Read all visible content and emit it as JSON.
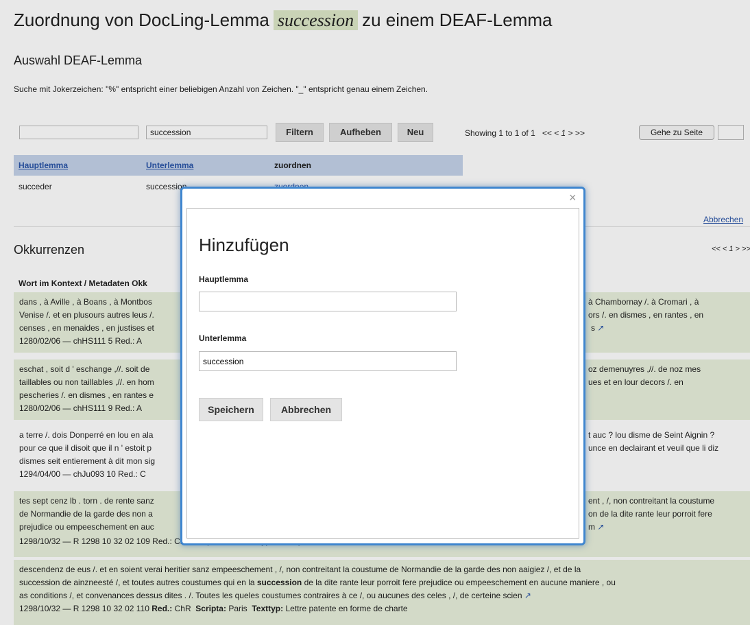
{
  "header": {
    "title_prefix": "Zuordnung von DocLing-Lemma",
    "title_lemma": "succession",
    "title_suffix": "zu einem DEAF-Lemma",
    "subtitle": "Auswahl DEAF-Lemma",
    "hint": "Suche mit Jokerzeichen: \"%\" entspricht einer beliebigen Anzahl von Zeichen. \"_\" entspricht genau einem Zeichen."
  },
  "filter": {
    "hauptlemma_value": "",
    "unterlemma_value": "succession",
    "filter_label": "Filtern",
    "reset_label": "Aufheben",
    "new_label": "Neu",
    "showing": "Showing 1 to 1 of 1",
    "pager": "<< < 1 > >>",
    "goto_label": "Gehe zu Seite",
    "goto_value": ""
  },
  "table": {
    "headers": [
      "Hauptlemma",
      "Unterlemma",
      "zuordnen"
    ],
    "row": [
      "succeder",
      "succession",
      "zuordnen"
    ]
  },
  "cancel_link": "Abbrechen",
  "occurrences": {
    "title": "Okkurrenzen",
    "pager": "<< < 1 > >>",
    "context_header": "Wort im Kontext / Metadaten Okk",
    "items": [
      {
        "left": "dans , à Aville , à Boans , à Montbos",
        "right": "à Chambornay /. à Cromari , à",
        "left2": "Venise /. et en plusours autres leus /.",
        "right2": "ors /. en dismes , en rantes , en",
        "left3": "censes , en menaides , en justises et",
        "right3": "s",
        "meta": "1280/02/06 — chHS111  5  Red.: A"
      },
      {
        "left": "eschat , soit d ' eschange ,//. soit de",
        "right": "oz demenuyres ,//. de noz mes",
        "left2": "taillables ou non taillables ,//. en hom",
        "right2": "ues et en lour decors /. en",
        "left3": "pescheries /. en dismes , en rantes e",
        "right3": "",
        "meta": "1280/02/06 — chHS111  9  Red.: A"
      },
      {
        "left": "a terre /. dois Donperré en lou en ala",
        "right": "t auc ? lou disme de Seint Aignin ?",
        "left2": "pour ce que il disoit que il n ' estoit p",
        "right2": "unce en declairant et veuil que li diz",
        "left3": "dismes seit entierement à dit mon sig",
        "right3": "",
        "meta": "1294/04/00 — chJu093  10  Red.: C"
      },
      {
        "left": "tes sept cenz lb . torn . de rente sanz",
        "right": "ent , /, non contreitant la coustume",
        "left2": "de Normandie de la garde des non a",
        "right2": "on de la dite rante leur porroit fere",
        "left3": "prejudice ou empeeschement en auc",
        "right3": "m",
        "meta": "1298/10/32 — R 1298 10 32 02  109  Red.: ChR  Scripta: Paris  Texttyp: Lettre patente en forme de charte"
      }
    ],
    "last": {
      "line1": "descendenz de eus /. et en soient verai heritier sanz empeeschement , /, non contreitant la coustume de Normandie de la garde des non aaigiez /, et de la",
      "line2a": "succession de ainzneesté /, et toutes autres coustumes qui en la ",
      "line2kw": "succession",
      "line2b": " de la dite rante leur porroit fere prejudice ou empeeschement en aucune maniere , ou",
      "line3": "as conditions /, et convenances dessus dites . /. Toutes les queles coustumes contraires à ce /, ou aucunes des celes , /, de certeine scien",
      "meta_a": "1298/10/32 — R 1298 10 32 02  110  ",
      "red_label": "Red.:",
      "red_val": "ChR",
      "scripta_label": "Scripta:",
      "scripta_val": "Paris",
      "texttyp_label": "Texttyp:",
      "texttyp_val": "Lettre patente en forme de charte"
    }
  },
  "modal": {
    "title": "Hinzufügen",
    "hauptlemma_label": "Hauptlemma",
    "hauptlemma_value": "",
    "unterlemma_label": "Unterlemma",
    "unterlemma_value": "succession",
    "save_label": "Speichern",
    "cancel_label": "Abbrechen",
    "close_glyph": "×"
  }
}
